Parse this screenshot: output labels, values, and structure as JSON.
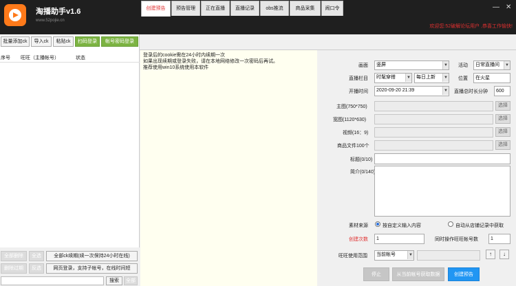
{
  "app": {
    "title": "淘播助手v1.6",
    "subtitle": "www.52pojie.cn",
    "welcome": "欢迎您:52破解论坛用户  ,恭喜工作愉快!"
  },
  "window_controls": {
    "minimize": "—",
    "close": "✕"
  },
  "left": {
    "buttons": {
      "batch_add": "批量添加ck",
      "import": "导入ck",
      "paste": "粘贴ck",
      "scan_login": "扫码登录",
      "pwd_login": "帐号密码登录"
    },
    "columns": [
      "序号",
      "旺旺（主播帐号）",
      "状态"
    ],
    "footer": {
      "delete_all": "全部删除",
      "select_all_1": "全选",
      "renew_all": "全部ck续期(续一次保持24小时在线)",
      "delete_expired": "删除过期",
      "invert": "反选",
      "web_login": "网页登录，支持子帐号，在线时间短",
      "search": "搜索",
      "all": "全部"
    }
  },
  "tabs": [
    "创建预告",
    "预告管理",
    "正在直播",
    "直播记录",
    "obs推流",
    "商品采集",
    "闹口令"
  ],
  "log_lines": [
    "登录后的cookie需在24小时内续期一次",
    "如果出现续期或登录失败，请在本地网络修改一次密码后再试。",
    "推荐使用win10系统使用本软件"
  ],
  "form": {
    "screen_label": "画面",
    "screen_value": "竖屏",
    "activity_label": "活动",
    "activity_value": "日常直播间",
    "column_label": "直播栏目",
    "column_value": "时髦穿搭",
    "column_value2": "每日上新",
    "location_label": "位置",
    "location_value": "在火星",
    "start_time_label": "开播时间",
    "start_time_value": "2020-09-20 21:39",
    "duration_label": "直播总时长分钟",
    "duration_value": "600",
    "main_image_label": "主图(750*750)",
    "wide_image_label": "宽图(1120*630)",
    "video_label": "视频(16：9)",
    "product_file_label": "商品文件100个",
    "pick_label": "选择",
    "title_label": "标题(0/10)",
    "intro_label": "简介(0/140)",
    "source_label": "素材来源",
    "source_opt1": "按自定义输入内容",
    "source_opt2": "自动从店铺记录中获取",
    "create_count_label": "创建次数",
    "create_count_value": "1",
    "concurrent_label": "同时操作旺旺帐号数",
    "concurrent_value": "1",
    "ww_range_label": "旺旺使用范围",
    "ww_range_value": "当前帐号",
    "up_label": "↑",
    "down_label": "↓",
    "stop_button": "停止",
    "fetch_button": "从当前帐号获取数据",
    "create_button": "创建预告"
  },
  "colors": {
    "titlebar": "#1f1f1f",
    "accent_red": "#e03030",
    "green": "#7cb342",
    "blue": "#2196f3"
  }
}
